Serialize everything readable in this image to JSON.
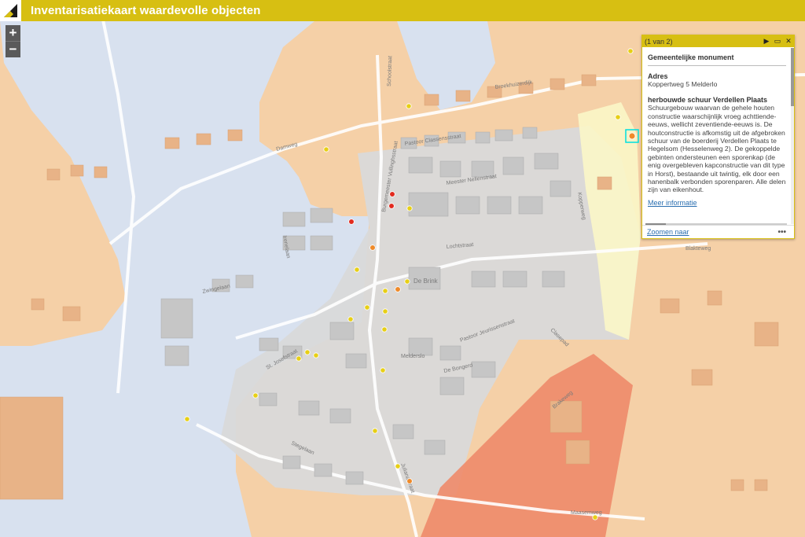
{
  "header": {
    "title": "Inventarisatiekaart waardevolle objecten"
  },
  "zoom": {
    "in_label": "+",
    "out_label": "−"
  },
  "popup": {
    "count": "(1 van 2)",
    "title": "Gemeentelijke monument",
    "fields": [
      {
        "label": "Adres",
        "value": "Koppertweg 5 Melderlo"
      },
      {
        "label": "herbouwde schuur Verdellen Plaats",
        "value": "Schuurgebouw waarvan de gehele houten constructie waarschijnlijk vroeg achttiende-eeuws, wellicht zeventiende-eeuws is. De houtconstructie is afkomstig uit de afgebroken schuur van de boerderij Verdellen Plaats te Hegelsom (Hesselenweg 2). De gekoppelde gebinten ondersteunen een sporenkap (de enig overgebleven kapconstructie van dit type in Horst), bestaande uit twintig, elk door een hanenbalk verbonden sporenparen. Alle delen zijn van eikenhout."
      }
    ],
    "more_link": "Meer informatie",
    "zoom_link": "Zoomen naar",
    "menu": "•••"
  },
  "map": {
    "colors": {
      "background": "#f3e3cf",
      "orange_zone": "#f6c999",
      "blue_zone": "#d6e1f2",
      "gray_zone": "#d9d9d9",
      "red_zone": "#ee8a6a",
      "yellow_zone": "#fbf6c8",
      "marker_yellow": "#e7cf16",
      "marker_orange": "#ef8a2a",
      "marker_red": "#e22b1f"
    },
    "street_labels": [
      "Damweg",
      "Broekhuizerdijk",
      "Pastoor Classensstraat",
      "Meester Nellenstraat",
      "Lochtstraat",
      "De Brink",
      "Zwingelaan",
      "St. Josefstraat",
      "Melderslo",
      "De Bongerd",
      "Pastoor Jeurissenstraat",
      "Kopperweg",
      "Blakteweg",
      "Stegelaan",
      "Maasemweg",
      "Burgemeester Vullinghsstraat",
      "Schoolstraat",
      "Irenelaan",
      "Brakeweg",
      "Julianastraat",
      "Clasepad"
    ]
  }
}
